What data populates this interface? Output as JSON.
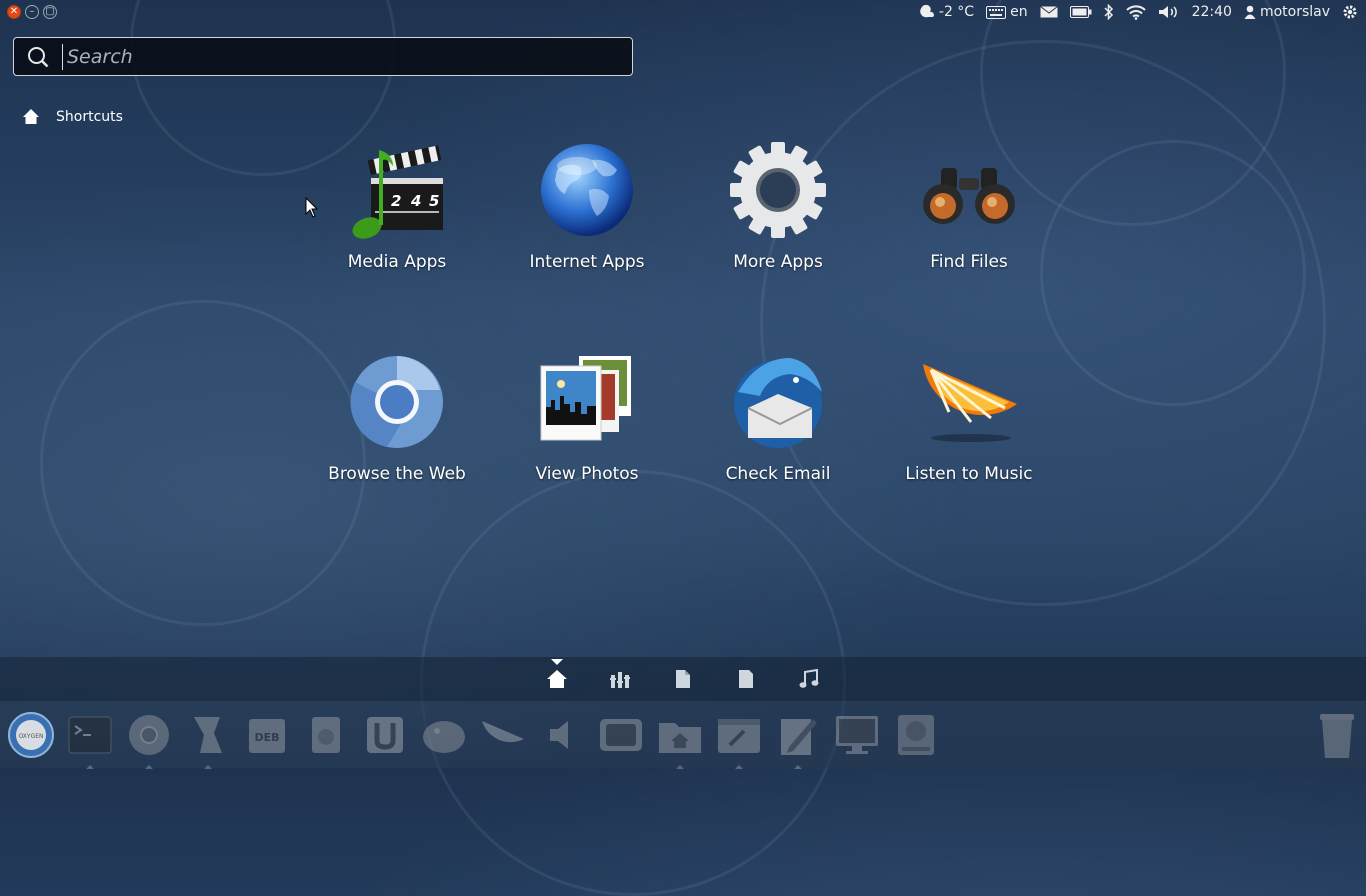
{
  "top_panel": {
    "weather": "-2 °C",
    "keyboard_layout": "en",
    "time": "22:40",
    "username": "motorslav",
    "icons": [
      "close-icon",
      "minimize-icon",
      "maximize-icon",
      "weather-icon",
      "keyboard-icon",
      "mail-icon",
      "battery-icon",
      "bluetooth-icon",
      "wifi-icon",
      "volume-icon",
      "user-icon",
      "session-gear-icon"
    ]
  },
  "search": {
    "placeholder": "Search",
    "value": ""
  },
  "category": {
    "label": "Shortcuts",
    "icon": "home-icon"
  },
  "apps": [
    {
      "label": "Media Apps",
      "icon": "media-apps-icon"
    },
    {
      "label": "Internet Apps",
      "icon": "internet-apps-icon"
    },
    {
      "label": "More Apps",
      "icon": "more-apps-gear-icon"
    },
    {
      "label": "Find Files",
      "icon": "binoculars-icon"
    },
    {
      "label": "Browse the Web",
      "icon": "chromium-icon"
    },
    {
      "label": "View Photos",
      "icon": "photos-icon"
    },
    {
      "label": "Check Email",
      "icon": "thunderbird-icon"
    },
    {
      "label": "Listen to Music",
      "icon": "music-orange-icon"
    }
  ],
  "lenses": [
    "home-lens-icon",
    "applications-lens-icon",
    "files-lens-icon",
    "documents-lens-icon",
    "music-lens-icon"
  ],
  "launcher": [
    "dash-button-icon",
    "terminal-icon",
    "chromium-icon",
    "gimp-icon",
    "deb-package-icon",
    "software-center-icon",
    "ubuntu-one-icon",
    "thunderbird-icon",
    "music-player-icon",
    "volume-icon",
    "tv-icon",
    "home-folder-icon",
    "system-settings-icon",
    "text-editor-icon",
    "monitor-icon",
    "disk-icon",
    "trash-icon"
  ],
  "colors": {
    "accent_close": "#df4a16",
    "background": "#2a4668"
  }
}
